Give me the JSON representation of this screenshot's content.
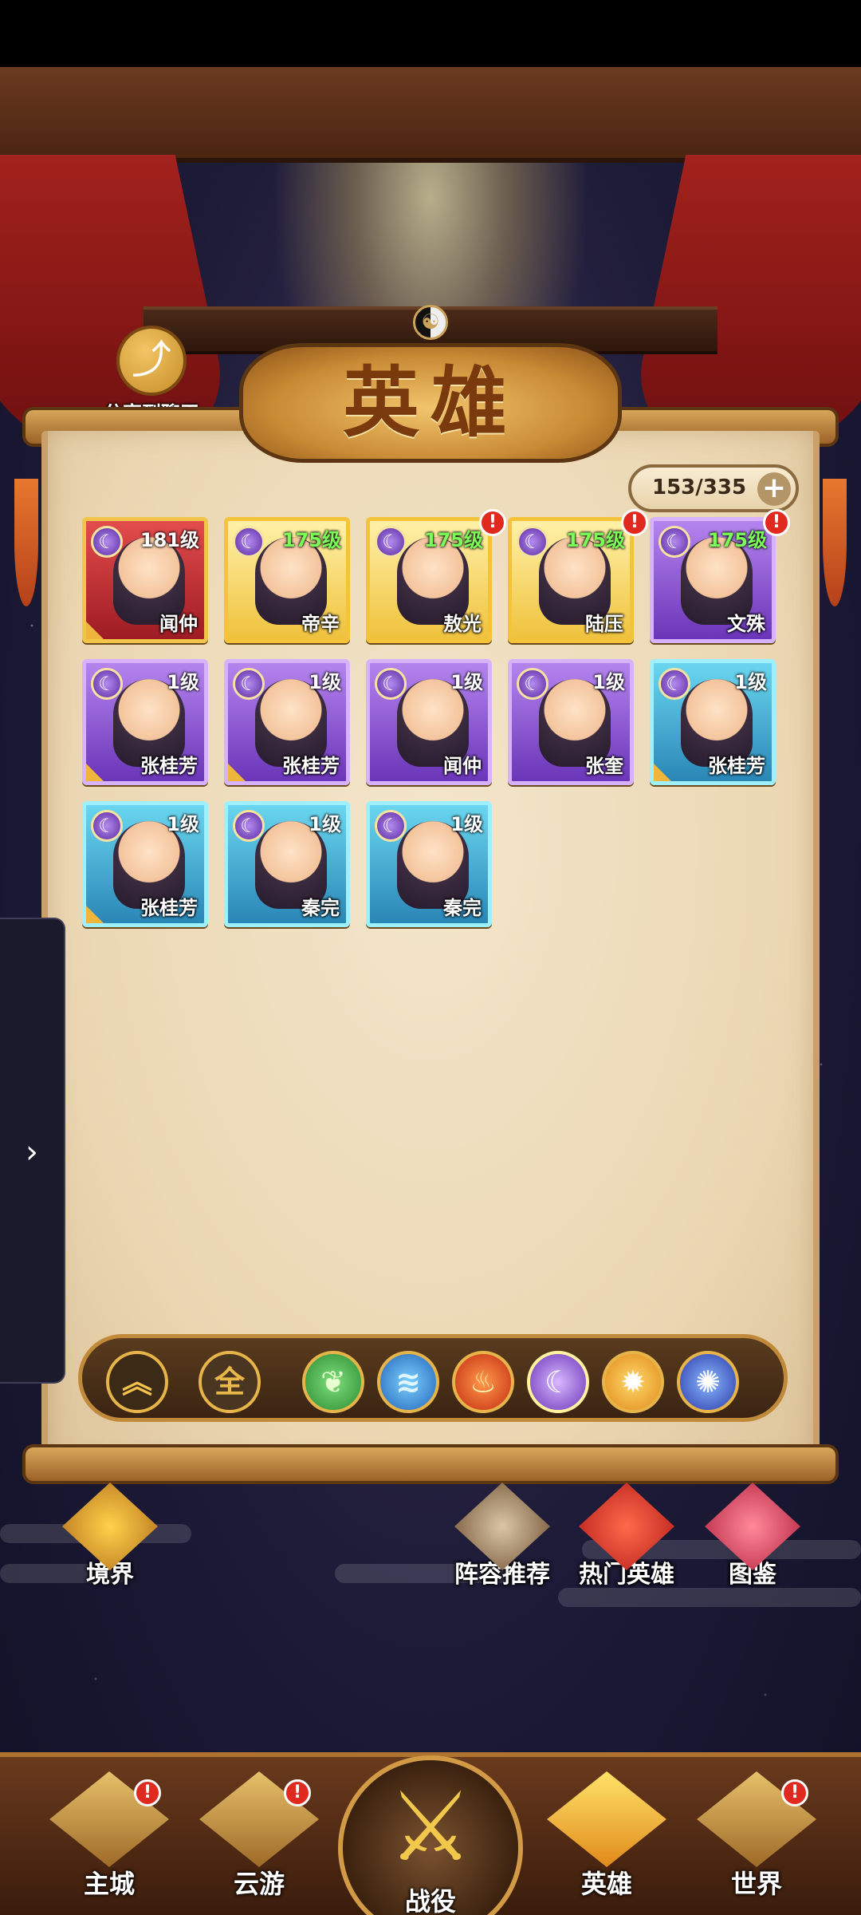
{
  "share": {
    "label": "分享到聊天",
    "icon": "share-icon"
  },
  "title": "英雄",
  "hero_count": "153/335",
  "heroes": [
    {
      "name": "闻仲",
      "level": "181级",
      "frame": "red"
    },
    {
      "name": "帝辛",
      "level": "175级",
      "frame": "gold"
    },
    {
      "name": "敖光",
      "level": "175级",
      "frame": "gold"
    },
    {
      "name": "陆压",
      "level": "175级",
      "frame": "gold"
    },
    {
      "name": "文殊",
      "level": "175级",
      "frame": "purple"
    },
    {
      "name": "张桂芳",
      "level": "1级",
      "frame": "purple"
    },
    {
      "name": "张桂芳",
      "level": "1级",
      "frame": "purple"
    },
    {
      "name": "闻仲",
      "level": "1级",
      "frame": "purple"
    },
    {
      "name": "张奎",
      "level": "1级",
      "frame": "purple"
    },
    {
      "name": "张桂芳",
      "level": "1级",
      "frame": "blue"
    },
    {
      "name": "张桂芳",
      "level": "1级",
      "frame": "blue"
    },
    {
      "name": "秦完",
      "level": "1级",
      "frame": "blue"
    },
    {
      "name": "秦完",
      "level": "1级",
      "frame": "blue"
    }
  ],
  "alerts": {
    "badge": "!"
  },
  "filters": {
    "sort_icon": "chevron-up-double-icon",
    "all_label": "全",
    "elements": [
      "wood-element-icon",
      "water-element-icon",
      "fire-element-icon",
      "moon-element-icon",
      "sun-element-icon",
      "vortex-element-icon"
    ]
  },
  "side_tab": {
    "icon": "chevron-right-icon"
  },
  "features": {
    "realm": "境界",
    "lineup": "阵容推荐",
    "popular": "热门英雄",
    "codex": "图鉴"
  },
  "nav": {
    "main_city": "主城",
    "travel": "云游",
    "battle": "战役",
    "heroes": "英雄",
    "world": "世界"
  }
}
